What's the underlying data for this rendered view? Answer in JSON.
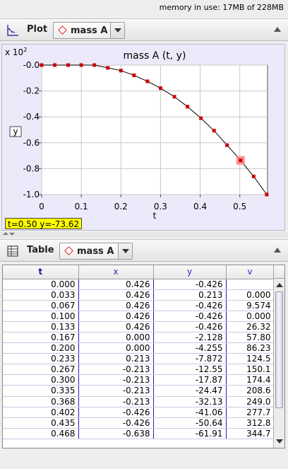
{
  "status": {
    "memory": "memory in use: 17MB of 228MB"
  },
  "plot_panel": {
    "title": "Plot",
    "combo_value": "mass A",
    "icons": {
      "panel": "plot-icon",
      "combo": "red-diamond-icon",
      "collapse": "collapse-triangle-icon"
    }
  },
  "plot": {
    "scale_label": "x 10",
    "scale_exp": "2",
    "ybox_label": "y",
    "readout": "t=0.50  y=-73.62",
    "colors": {
      "background": "#eceafa",
      "marker": "#cc0000",
      "highlight": "#ff8080",
      "line": "#000000"
    }
  },
  "chart_data": {
    "type": "line",
    "title": "mass A (t, y)",
    "xlabel": "t",
    "ylabel": "y",
    "xlim": [
      0,
      0.57
    ],
    "ylim": [
      -1.0,
      0.0
    ],
    "xticks": [
      "0",
      "0.1",
      "0.2",
      "0.3",
      "0.4",
      "0.5"
    ],
    "yticks": [
      "-0.0",
      "-0.2",
      "-0.4",
      "-0.6",
      "-0.8",
      "-1.0"
    ],
    "grid": true,
    "x": [
      0.0,
      0.033,
      0.067,
      0.1,
      0.133,
      0.167,
      0.2,
      0.233,
      0.267,
      0.3,
      0.335,
      0.368,
      0.402,
      0.435,
      0.468,
      0.502,
      0.535,
      0.568
    ],
    "y": [
      0.0,
      0.0,
      0.0,
      0.0,
      0.0,
      -0.0213,
      -0.0426,
      -0.0787,
      -0.1255,
      -0.1787,
      -0.2447,
      -0.3213,
      -0.4106,
      -0.5064,
      -0.6191,
      -0.7362,
      -0.86,
      -1.0
    ],
    "highlight_index": 15
  },
  "table_panel": {
    "title": "Table",
    "combo_value": "mass A",
    "icons": {
      "panel": "table-grid-icon",
      "combo": "red-diamond-icon",
      "collapse": "collapse-triangle-icon"
    }
  },
  "table": {
    "columns": [
      "t",
      "x",
      "y",
      "v"
    ],
    "rows": [
      [
        "0.000",
        "0.426",
        "-0.426",
        ""
      ],
      [
        "0.033",
        "0.426",
        "0.213",
        "0.000"
      ],
      [
        "0.067",
        "0.426",
        "-0.426",
        "9.574"
      ],
      [
        "0.100",
        "0.426",
        "-0.426",
        "0.000"
      ],
      [
        "0.133",
        "0.426",
        "-0.426",
        "26.32"
      ],
      [
        "0.167",
        "0.000",
        "-2.128",
        "57.80"
      ],
      [
        "0.200",
        "0.000",
        "-4.255",
        "86.23"
      ],
      [
        "0.233",
        "0.213",
        "-7.872",
        "124.5"
      ],
      [
        "0.267",
        "-0.213",
        "-12.55",
        "150.1"
      ],
      [
        "0.300",
        "-0.213",
        "-17.87",
        "174.4"
      ],
      [
        "0.335",
        "-0.213",
        "-24.47",
        "208.6"
      ],
      [
        "0.368",
        "-0.213",
        "-32.13",
        "249.0"
      ],
      [
        "0.402",
        "-0.426",
        "-41.06",
        "277.7"
      ],
      [
        "0.435",
        "-0.426",
        "-50.64",
        "312.8"
      ],
      [
        "0.468",
        "-0.638",
        "-61.91",
        "344.7"
      ]
    ],
    "scroll_fraction": 0.83
  }
}
